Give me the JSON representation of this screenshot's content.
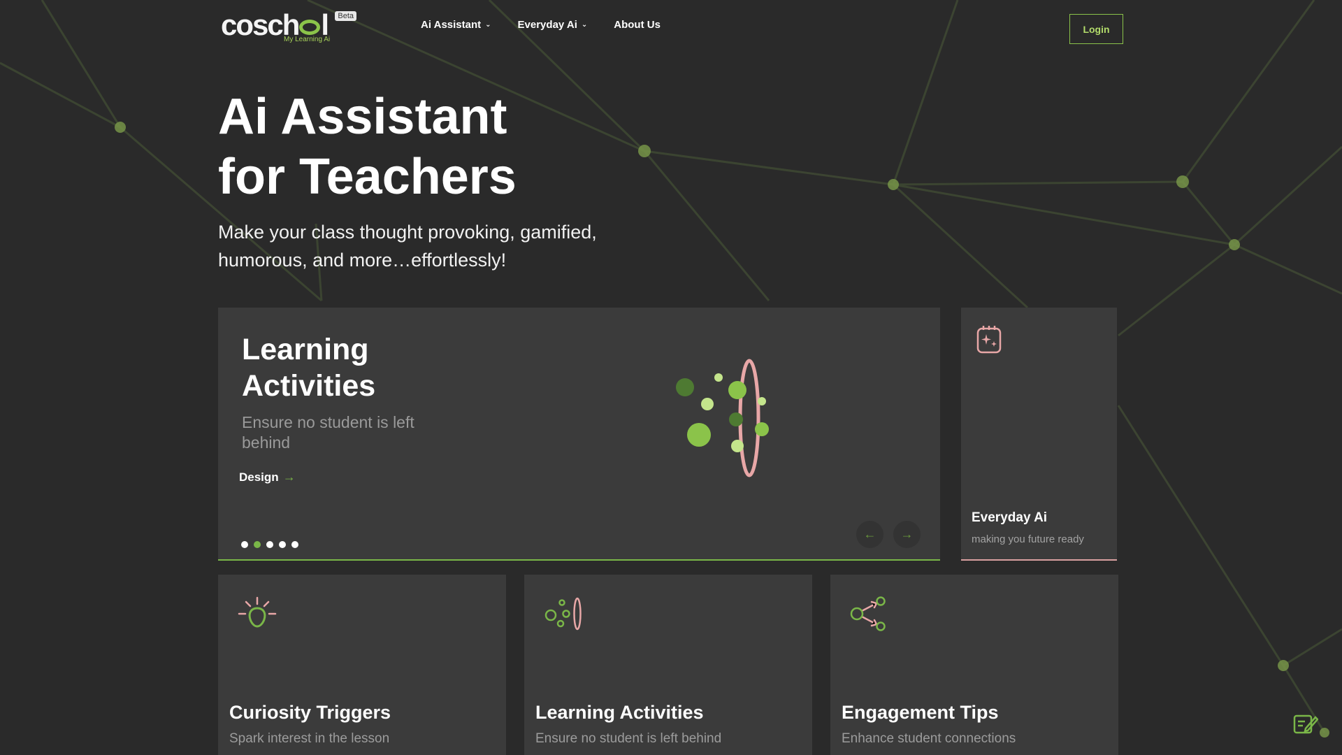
{
  "colors": {
    "accent": "#7ab648",
    "accent_light": "#b3dc6b",
    "pink": "#e8a7a7",
    "bg": "#2a2a2a",
    "card": "#3b3b3b"
  },
  "header": {
    "logo_text": "cosch l",
    "logo_beta": "Beta",
    "logo_tagline": "My Learning Ai",
    "nav": [
      {
        "label": "Ai Assistant",
        "icon": "chevron-down-icon"
      },
      {
        "label": "Everyday Ai",
        "icon": "chevron-down-icon"
      },
      {
        "label": "About Us"
      }
    ],
    "login_label": "Login"
  },
  "hero": {
    "title_line1": "Ai Assistant",
    "title_line2": "for Teachers",
    "subtitle": "Make your class thought provoking, gamified, humorous, and more…effortlessly!"
  },
  "carousel": {
    "title": "Learning Activities",
    "subtitle": "Ensure no student is left behind",
    "link_label": "Design",
    "link_icon": "arrow-right-icon",
    "slide_count": 5,
    "active_slide": 2,
    "prev_icon": "arrow-left-icon",
    "next_icon": "arrow-right-icon"
  },
  "side_card": {
    "icon": "calendar-sparkle-icon",
    "title": "Everyday Ai",
    "subtitle": "making you future ready"
  },
  "cards": [
    {
      "icon": "lightbulb-icon",
      "title": "Curiosity Triggers",
      "subtitle": "Spark interest in the lesson"
    },
    {
      "icon": "bubbles-ring-icon",
      "title": "Learning Activities",
      "subtitle": "Ensure no student is left behind"
    },
    {
      "icon": "share-nodes-icon",
      "title": "Engagement Tips",
      "subtitle": "Enhance student connections"
    }
  ],
  "feedback_icon": "edit-note-icon"
}
